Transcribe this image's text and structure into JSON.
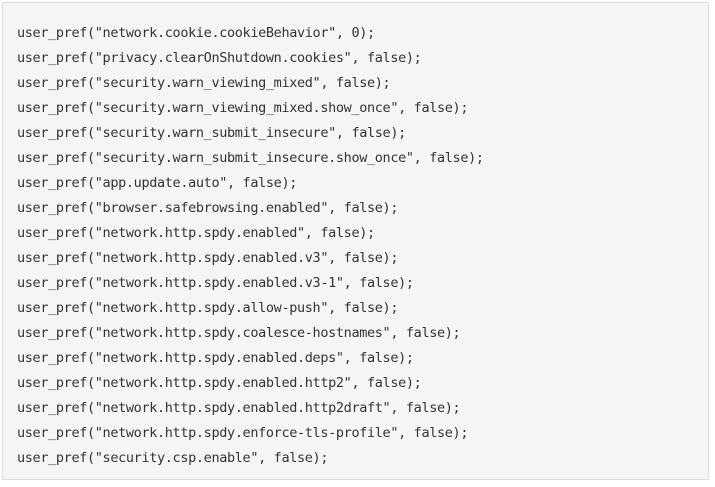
{
  "code_block": {
    "lines": [
      "user_pref(\"network.cookie.cookieBehavior\", 0);",
      "user_pref(\"privacy.clearOnShutdown.cookies\", false);",
      "user_pref(\"security.warn_viewing_mixed\", false);",
      "user_pref(\"security.warn_viewing_mixed.show_once\", false);",
      "user_pref(\"security.warn_submit_insecure\", false);",
      "user_pref(\"security.warn_submit_insecure.show_once\", false);",
      "user_pref(\"app.update.auto\", false);",
      "user_pref(\"browser.safebrowsing.enabled\", false);",
      "user_pref(\"network.http.spdy.enabled\", false);",
      "user_pref(\"network.http.spdy.enabled.v3\", false);",
      "user_pref(\"network.http.spdy.enabled.v3-1\", false);",
      "user_pref(\"network.http.spdy.allow-push\", false);",
      "user_pref(\"network.http.spdy.coalesce-hostnames\", false);",
      "user_pref(\"network.http.spdy.enabled.deps\", false);",
      "user_pref(\"network.http.spdy.enabled.http2\", false);",
      "user_pref(\"network.http.spdy.enabled.http2draft\", false);",
      "user_pref(\"network.http.spdy.enforce-tls-profile\", false);",
      "user_pref(\"security.csp.enable\", false);"
    ]
  }
}
